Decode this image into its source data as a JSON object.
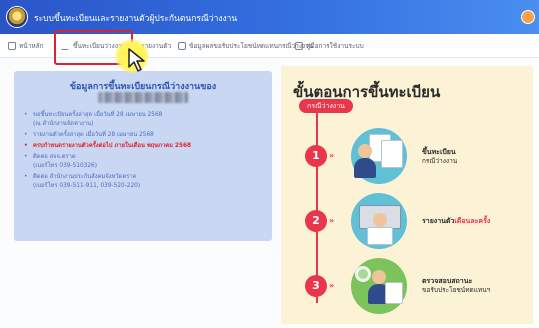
{
  "header": {
    "app_title": "ระบบขึ้นทะเบียนและรายงานตัวผู้ประกันตนกรณีว่างงาน"
  },
  "nav": {
    "items": [
      {
        "label": "หน้าหลัก",
        "icon": "home-icon"
      },
      {
        "label": "ขึ้นทะเบียนว่างงาน",
        "icon": "pulse-icon"
      },
      {
        "label": "รายงานตัว",
        "icon": "none"
      },
      {
        "label": "ข้อมูลผลขอรับประโยชน์ทดแทนกรณีว่างงาน",
        "icon": "id-card-icon"
      },
      {
        "label": "คู่มือการใช้งานระบบ",
        "icon": "document-icon"
      }
    ]
  },
  "info": {
    "title": "ข้อมูลการขึ้นทะเบียนกรณีว่างงานของ",
    "items": [
      {
        "line1": "ขอขึ้นทะเบียนครั้งล่าสุด เมื่อวันที่ 28 เมษายน 2568",
        "line2": "(ณ สำนักงานจัดหางาน)",
        "emphasis": false
      },
      {
        "line1": "รายงานตัวครั้งล่าสุด เมื่อวันที่ 28 เมษายน 2568",
        "line2": "",
        "emphasis": false
      },
      {
        "line1": "ครบกำหนดรายงานตัวครั้งต่อไป ภายในเดือน พฤษภาคม 2568",
        "line2": "",
        "emphasis": true
      },
      {
        "line1": "ติดต่อ สจจ.ตราด",
        "line2": "(เบอร์โทร 039-510326)",
        "emphasis": false
      },
      {
        "line1": "ติดต่อ สำนักงานประกันสังคมจังหวัดตราด",
        "line2": "(เบอร์โทร 039-511-911, 039-520-220)",
        "emphasis": false
      }
    ]
  },
  "steps": {
    "title": "ขั้นตอนการขึ้นทะเบียน",
    "badge": "กรณีว่างงาน",
    "items": [
      {
        "num": "1",
        "line1": "ขึ้นทะเบียน",
        "line1_red": "",
        "line2": "กรณีว่างงาน"
      },
      {
        "num": "2",
        "line1": "รายงานตัว",
        "line1_red": "เดือนละครั้ง",
        "line2": ""
      },
      {
        "num": "3",
        "line1": "ตรวจสอบสถานะ",
        "line1_red": "",
        "line2": "ขอรับประโยชน์ทดแทนฯ"
      }
    ]
  },
  "colors": {
    "header_blue": "#2a55c7",
    "accent_red": "#e8364b",
    "info_panel": "#c9d7f3",
    "steps_panel": "#fcf3d6",
    "highlight_red": "#d42534"
  }
}
